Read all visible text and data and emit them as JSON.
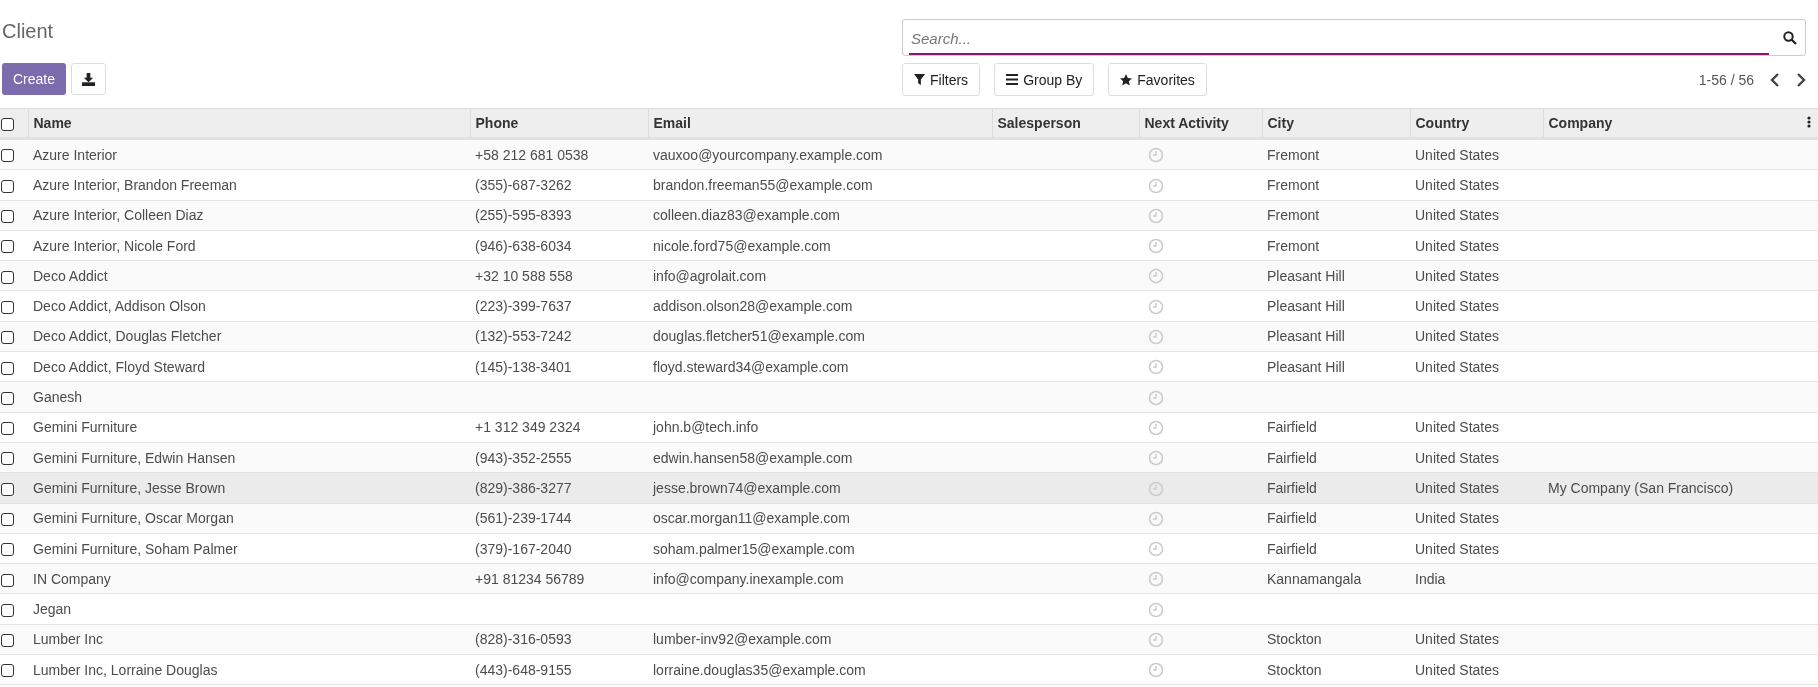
{
  "title": "Client",
  "buttons": {
    "create": "Create"
  },
  "search": {
    "placeholder": "Search..."
  },
  "filters": [
    {
      "kind": "filter",
      "label": "Filters"
    },
    {
      "kind": "group",
      "label": "Group By"
    },
    {
      "kind": "favorite",
      "label": "Favorites"
    }
  ],
  "pager": "1-56 / 56",
  "table": {
    "select_all": {
      "checked": false
    },
    "columns": [
      "Name",
      "Phone",
      "Email",
      "Salesperson",
      "Next Activity",
      "City",
      "Country",
      "Company"
    ],
    "rows": [
      {
        "checked": false,
        "highlighted": false,
        "name": "Azure Interior",
        "phone": "+58 212 681 0538",
        "email": "vauxoo@yourcompany.example.com",
        "city": "Fremont",
        "country": "United States"
      },
      {
        "checked": false,
        "highlighted": false,
        "name": "Azure Interior, Brandon Freeman",
        "phone": "(355)-687-3262",
        "email": "brandon.freeman55@example.com",
        "city": "Fremont",
        "country": "United States"
      },
      {
        "checked": false,
        "highlighted": false,
        "name": "Azure Interior, Colleen Diaz",
        "phone": "(255)-595-8393",
        "email": "colleen.diaz83@example.com",
        "city": "Fremont",
        "country": "United States"
      },
      {
        "checked": false,
        "highlighted": false,
        "name": "Azure Interior, Nicole Ford",
        "phone": "(946)-638-6034",
        "email": "nicole.ford75@example.com",
        "city": "Fremont",
        "country": "United States"
      },
      {
        "checked": false,
        "highlighted": false,
        "name": "Deco Addict",
        "phone": "+32 10 588 558",
        "email": "info@agrolait.com",
        "city": "Pleasant Hill",
        "country": "United States"
      },
      {
        "checked": false,
        "highlighted": false,
        "name": "Deco Addict, Addison Olson",
        "phone": "(223)-399-7637",
        "email": "addison.olson28@example.com",
        "city": "Pleasant Hill",
        "country": "United States"
      },
      {
        "checked": false,
        "highlighted": false,
        "name": "Deco Addict, Douglas Fletcher",
        "phone": "(132)-553-7242",
        "email": "douglas.fletcher51@example.com",
        "city": "Pleasant Hill",
        "country": "United States"
      },
      {
        "checked": false,
        "highlighted": false,
        "name": "Deco Addict, Floyd Steward",
        "phone": "(145)-138-3401",
        "email": "floyd.steward34@example.com",
        "city": "Pleasant Hill",
        "country": "United States"
      },
      {
        "checked": false,
        "highlighted": false,
        "name": "Ganesh"
      },
      {
        "checked": false,
        "highlighted": false,
        "name": "Gemini Furniture",
        "phone": "+1 312 349 2324",
        "email": "john.b@tech.info",
        "city": "Fairfield",
        "country": "United States"
      },
      {
        "checked": false,
        "highlighted": false,
        "name": "Gemini Furniture, Edwin Hansen",
        "phone": "(943)-352-2555",
        "email": "edwin.hansen58@example.com",
        "city": "Fairfield",
        "country": "United States"
      },
      {
        "checked": false,
        "highlighted": true,
        "name": "Gemini Furniture, Jesse Brown",
        "phone": "(829)-386-3277",
        "email": "jesse.brown74@example.com",
        "city": "Fairfield",
        "country": "United States",
        "company": "My Company (San Francisco)"
      },
      {
        "checked": false,
        "highlighted": false,
        "name": "Gemini Furniture, Oscar Morgan",
        "phone": "(561)-239-1744",
        "email": "oscar.morgan11@example.com",
        "city": "Fairfield",
        "country": "United States"
      },
      {
        "checked": false,
        "highlighted": false,
        "name": "Gemini Furniture, Soham Palmer",
        "phone": "(379)-167-2040",
        "email": "soham.palmer15@example.com",
        "city": "Fairfield",
        "country": "United States"
      },
      {
        "checked": false,
        "highlighted": false,
        "name": "IN Company",
        "phone": "+91 81234 56789",
        "email": "info@company.inexample.com",
        "city": "Kannamangala",
        "country": "India"
      },
      {
        "checked": false,
        "highlighted": false,
        "name": "Jegan"
      },
      {
        "checked": false,
        "highlighted": false,
        "name": "Lumber Inc",
        "phone": "(828)-316-0593",
        "email": "lumber-inv92@example.com",
        "city": "Stockton",
        "country": "United States"
      },
      {
        "checked": false,
        "highlighted": false,
        "name": "Lumber Inc, Lorraine Douglas",
        "phone": "(443)-648-9155",
        "email": "lorraine.douglas35@example.com",
        "city": "Stockton",
        "country": "United States"
      }
    ]
  }
}
